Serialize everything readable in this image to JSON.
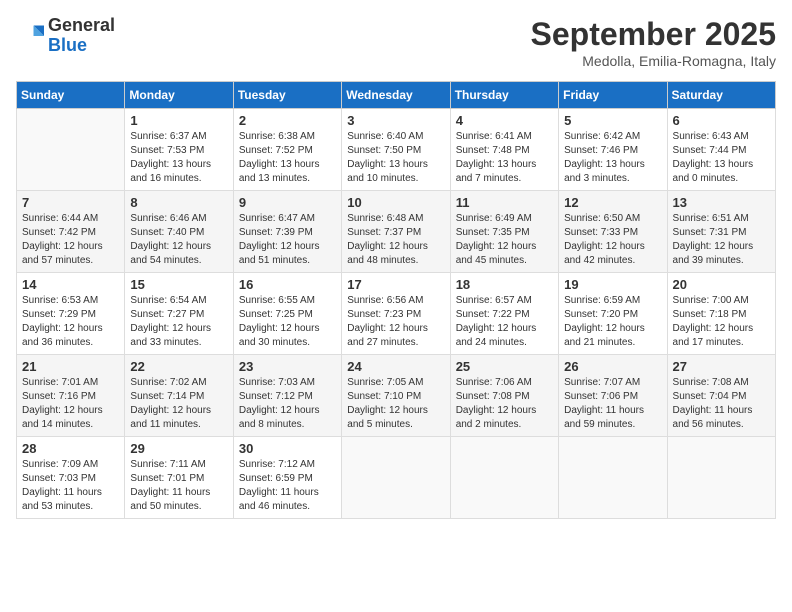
{
  "logo": {
    "general": "General",
    "blue": "Blue"
  },
  "header": {
    "title": "September 2025",
    "subtitle": "Medolla, Emilia-Romagna, Italy"
  },
  "weekdays": [
    "Sunday",
    "Monday",
    "Tuesday",
    "Wednesday",
    "Thursday",
    "Friday",
    "Saturday"
  ],
  "weeks": [
    [
      {
        "day": "",
        "info": ""
      },
      {
        "day": "1",
        "info": "Sunrise: 6:37 AM\nSunset: 7:53 PM\nDaylight: 13 hours\nand 16 minutes."
      },
      {
        "day": "2",
        "info": "Sunrise: 6:38 AM\nSunset: 7:52 PM\nDaylight: 13 hours\nand 13 minutes."
      },
      {
        "day": "3",
        "info": "Sunrise: 6:40 AM\nSunset: 7:50 PM\nDaylight: 13 hours\nand 10 minutes."
      },
      {
        "day": "4",
        "info": "Sunrise: 6:41 AM\nSunset: 7:48 PM\nDaylight: 13 hours\nand 7 minutes."
      },
      {
        "day": "5",
        "info": "Sunrise: 6:42 AM\nSunset: 7:46 PM\nDaylight: 13 hours\nand 3 minutes."
      },
      {
        "day": "6",
        "info": "Sunrise: 6:43 AM\nSunset: 7:44 PM\nDaylight: 13 hours\nand 0 minutes."
      }
    ],
    [
      {
        "day": "7",
        "info": "Sunrise: 6:44 AM\nSunset: 7:42 PM\nDaylight: 12 hours\nand 57 minutes."
      },
      {
        "day": "8",
        "info": "Sunrise: 6:46 AM\nSunset: 7:40 PM\nDaylight: 12 hours\nand 54 minutes."
      },
      {
        "day": "9",
        "info": "Sunrise: 6:47 AM\nSunset: 7:39 PM\nDaylight: 12 hours\nand 51 minutes."
      },
      {
        "day": "10",
        "info": "Sunrise: 6:48 AM\nSunset: 7:37 PM\nDaylight: 12 hours\nand 48 minutes."
      },
      {
        "day": "11",
        "info": "Sunrise: 6:49 AM\nSunset: 7:35 PM\nDaylight: 12 hours\nand 45 minutes."
      },
      {
        "day": "12",
        "info": "Sunrise: 6:50 AM\nSunset: 7:33 PM\nDaylight: 12 hours\nand 42 minutes."
      },
      {
        "day": "13",
        "info": "Sunrise: 6:51 AM\nSunset: 7:31 PM\nDaylight: 12 hours\nand 39 minutes."
      }
    ],
    [
      {
        "day": "14",
        "info": "Sunrise: 6:53 AM\nSunset: 7:29 PM\nDaylight: 12 hours\nand 36 minutes."
      },
      {
        "day": "15",
        "info": "Sunrise: 6:54 AM\nSunset: 7:27 PM\nDaylight: 12 hours\nand 33 minutes."
      },
      {
        "day": "16",
        "info": "Sunrise: 6:55 AM\nSunset: 7:25 PM\nDaylight: 12 hours\nand 30 minutes."
      },
      {
        "day": "17",
        "info": "Sunrise: 6:56 AM\nSunset: 7:23 PM\nDaylight: 12 hours\nand 27 minutes."
      },
      {
        "day": "18",
        "info": "Sunrise: 6:57 AM\nSunset: 7:22 PM\nDaylight: 12 hours\nand 24 minutes."
      },
      {
        "day": "19",
        "info": "Sunrise: 6:59 AM\nSunset: 7:20 PM\nDaylight: 12 hours\nand 21 minutes."
      },
      {
        "day": "20",
        "info": "Sunrise: 7:00 AM\nSunset: 7:18 PM\nDaylight: 12 hours\nand 17 minutes."
      }
    ],
    [
      {
        "day": "21",
        "info": "Sunrise: 7:01 AM\nSunset: 7:16 PM\nDaylight: 12 hours\nand 14 minutes."
      },
      {
        "day": "22",
        "info": "Sunrise: 7:02 AM\nSunset: 7:14 PM\nDaylight: 12 hours\nand 11 minutes."
      },
      {
        "day": "23",
        "info": "Sunrise: 7:03 AM\nSunset: 7:12 PM\nDaylight: 12 hours\nand 8 minutes."
      },
      {
        "day": "24",
        "info": "Sunrise: 7:05 AM\nSunset: 7:10 PM\nDaylight: 12 hours\nand 5 minutes."
      },
      {
        "day": "25",
        "info": "Sunrise: 7:06 AM\nSunset: 7:08 PM\nDaylight: 12 hours\nand 2 minutes."
      },
      {
        "day": "26",
        "info": "Sunrise: 7:07 AM\nSunset: 7:06 PM\nDaylight: 11 hours\nand 59 minutes."
      },
      {
        "day": "27",
        "info": "Sunrise: 7:08 AM\nSunset: 7:04 PM\nDaylight: 11 hours\nand 56 minutes."
      }
    ],
    [
      {
        "day": "28",
        "info": "Sunrise: 7:09 AM\nSunset: 7:03 PM\nDaylight: 11 hours\nand 53 minutes."
      },
      {
        "day": "29",
        "info": "Sunrise: 7:11 AM\nSunset: 7:01 PM\nDaylight: 11 hours\nand 50 minutes."
      },
      {
        "day": "30",
        "info": "Sunrise: 7:12 AM\nSunset: 6:59 PM\nDaylight: 11 hours\nand 46 minutes."
      },
      {
        "day": "",
        "info": ""
      },
      {
        "day": "",
        "info": ""
      },
      {
        "day": "",
        "info": ""
      },
      {
        "day": "",
        "info": ""
      }
    ]
  ]
}
